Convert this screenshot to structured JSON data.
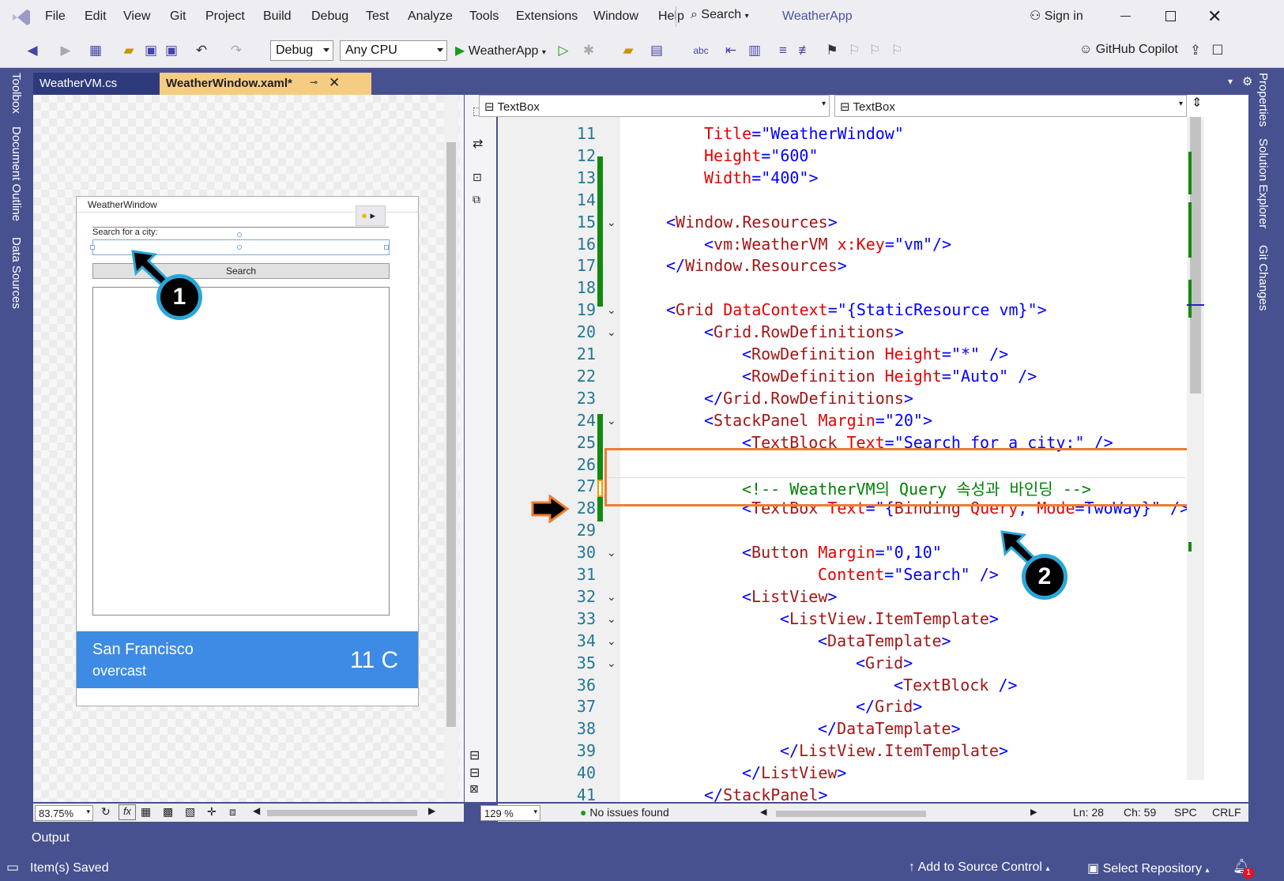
{
  "menu": {
    "items": [
      "File",
      "Edit",
      "View",
      "Git",
      "Project",
      "Build",
      "Debug",
      "Test",
      "Analyze",
      "Tools",
      "Extensions",
      "Window",
      "Help"
    ],
    "search_label": "Search",
    "app_title": "WeatherApp",
    "sign_in": "Sign in"
  },
  "toolbar": {
    "config": "Debug",
    "platform": "Any CPU",
    "run_target": "WeatherApp",
    "copilot": "GitHub Copilot"
  },
  "side_tabs": {
    "left": [
      "Toolbox",
      "Document Outline",
      "Data Sources"
    ],
    "right": [
      "Properties",
      "Solution Explorer",
      "Git Changes"
    ]
  },
  "tabs": [
    {
      "label": "WeatherVM.cs",
      "active": false
    },
    {
      "label": "WeatherWindow.xaml*",
      "active": true
    }
  ],
  "designer": {
    "window_title": "WeatherWindow",
    "search_label": "Search for a city:",
    "button_label": "Search",
    "city": "San Francisco",
    "condition": "overcast",
    "temperature": "11 C",
    "zoom": "83.75%"
  },
  "editor": {
    "element_dropdown_left": "TextBox",
    "element_dropdown_right": "TextBox",
    "zoom": "129 %",
    "issues": "No issues found",
    "ln": "Ln: 28",
    "ch": "Ch: 59",
    "spc": "SPC",
    "crlf": "CRLF",
    "lines": [
      {
        "n": "11",
        "indent": 2,
        "parts": [
          [
            "at",
            "Title"
          ],
          [
            "blue",
            "="
          ],
          [
            "val",
            "\"WeatherWindow\""
          ]
        ]
      },
      {
        "n": "12",
        "indent": 2,
        "parts": [
          [
            "at",
            "Height"
          ],
          [
            "blue",
            "="
          ],
          [
            "val",
            "\"600\""
          ]
        ]
      },
      {
        "n": "13",
        "indent": 2,
        "parts": [
          [
            "at",
            "Width"
          ],
          [
            "blue",
            "="
          ],
          [
            "val",
            "\"400\""
          ],
          [
            "blue",
            ">"
          ]
        ]
      },
      {
        "n": "14",
        "indent": 0,
        "parts": []
      },
      {
        "n": "15",
        "indent": 1,
        "parts": [
          [
            "blue",
            "<"
          ],
          [
            "tag",
            "Window.Resources"
          ],
          [
            "blue",
            ">"
          ]
        ]
      },
      {
        "n": "16",
        "indent": 2,
        "parts": [
          [
            "blue",
            "<"
          ],
          [
            "tag",
            "vm:WeatherVM"
          ],
          [
            "blue",
            " "
          ],
          [
            "at",
            "x:Key"
          ],
          [
            "blue",
            "="
          ],
          [
            "val",
            "\"vm\""
          ],
          [
            "blue",
            "/>"
          ]
        ]
      },
      {
        "n": "17",
        "indent": 1,
        "parts": [
          [
            "blue",
            "</"
          ],
          [
            "tag",
            "Window.Resources"
          ],
          [
            "blue",
            ">"
          ]
        ]
      },
      {
        "n": "18",
        "indent": 0,
        "parts": []
      },
      {
        "n": "19",
        "indent": 1,
        "parts": [
          [
            "blue",
            "<"
          ],
          [
            "tag",
            "Grid"
          ],
          [
            "blue",
            " "
          ],
          [
            "at",
            "DataContext"
          ],
          [
            "blue",
            "="
          ],
          [
            "val",
            "\"{StaticResource vm}\""
          ],
          [
            "blue",
            ">"
          ]
        ]
      },
      {
        "n": "20",
        "indent": 2,
        "parts": [
          [
            "blue",
            "<"
          ],
          [
            "tag",
            "Grid.RowDefinitions"
          ],
          [
            "blue",
            ">"
          ]
        ]
      },
      {
        "n": "21",
        "indent": 3,
        "parts": [
          [
            "blue",
            "<"
          ],
          [
            "tag",
            "RowDefinition"
          ],
          [
            "blue",
            " "
          ],
          [
            "at",
            "Height"
          ],
          [
            "blue",
            "="
          ],
          [
            "val",
            "\"*\""
          ],
          [
            "blue",
            " />"
          ]
        ]
      },
      {
        "n": "22",
        "indent": 3,
        "parts": [
          [
            "blue",
            "<"
          ],
          [
            "tag",
            "RowDefinition"
          ],
          [
            "blue",
            " "
          ],
          [
            "at",
            "Height"
          ],
          [
            "blue",
            "="
          ],
          [
            "val",
            "\"Auto\""
          ],
          [
            "blue",
            " />"
          ]
        ]
      },
      {
        "n": "23",
        "indent": 2,
        "parts": [
          [
            "blue",
            "</"
          ],
          [
            "tag",
            "Grid.RowDefinitions"
          ],
          [
            "blue",
            ">"
          ]
        ]
      },
      {
        "n": "24",
        "indent": 2,
        "parts": [
          [
            "blue",
            "<"
          ],
          [
            "tag",
            "StackPanel"
          ],
          [
            "blue",
            " "
          ],
          [
            "at",
            "Margin"
          ],
          [
            "blue",
            "="
          ],
          [
            "val",
            "\"20\""
          ],
          [
            "blue",
            ">"
          ]
        ]
      },
      {
        "n": "25",
        "indent": 3,
        "parts": [
          [
            "blue",
            "<"
          ],
          [
            "tag",
            "TextBlock"
          ],
          [
            "blue",
            " "
          ],
          [
            "at",
            "Text"
          ],
          [
            "blue",
            "="
          ],
          [
            "val",
            "\"Search for a city:\""
          ],
          [
            "blue",
            " />"
          ]
        ]
      },
      {
        "n": "26",
        "indent": 0,
        "parts": []
      },
      {
        "n": "27",
        "indent": 3,
        "parts": [
          [
            "com",
            "<!-- WeatherVM의 Query 속성과 바인딩 -->"
          ]
        ]
      },
      {
        "n": "28",
        "indent": 3,
        "parts": [
          [
            "blue",
            "<"
          ],
          [
            "tag",
            "TextBox"
          ],
          [
            "blue",
            " "
          ],
          [
            "at",
            "Text"
          ],
          [
            "blue",
            "=\"{"
          ],
          [
            "tag",
            "Binding"
          ],
          [
            "blue",
            " "
          ],
          [
            "at",
            "Query"
          ],
          [
            "blue",
            ", "
          ],
          [
            "at",
            "Mode"
          ],
          [
            "blue",
            "=TwoWay}\""
          ],
          [
            "blue",
            " />"
          ]
        ]
      },
      {
        "n": "29",
        "indent": 0,
        "parts": []
      },
      {
        "n": "30",
        "indent": 3,
        "parts": [
          [
            "blue",
            "<"
          ],
          [
            "tag",
            "Button"
          ],
          [
            "blue",
            " "
          ],
          [
            "at",
            "Margin"
          ],
          [
            "blue",
            "="
          ],
          [
            "val",
            "\"0,10\""
          ]
        ]
      },
      {
        "n": "31",
        "indent": 5,
        "parts": [
          [
            "at",
            "Content"
          ],
          [
            "blue",
            "="
          ],
          [
            "val",
            "\"Search\""
          ],
          [
            "blue",
            " />"
          ]
        ]
      },
      {
        "n": "32",
        "indent": 3,
        "parts": [
          [
            "blue",
            "<"
          ],
          [
            "tag",
            "ListView"
          ],
          [
            "blue",
            ">"
          ]
        ]
      },
      {
        "n": "33",
        "indent": 4,
        "parts": [
          [
            "blue",
            "<"
          ],
          [
            "tag",
            "ListView.ItemTemplate"
          ],
          [
            "blue",
            ">"
          ]
        ]
      },
      {
        "n": "34",
        "indent": 5,
        "parts": [
          [
            "blue",
            "<"
          ],
          [
            "tag",
            "DataTemplate"
          ],
          [
            "blue",
            ">"
          ]
        ]
      },
      {
        "n": "35",
        "indent": 6,
        "parts": [
          [
            "blue",
            "<"
          ],
          [
            "tag",
            "Grid"
          ],
          [
            "blue",
            ">"
          ]
        ]
      },
      {
        "n": "36",
        "indent": 7,
        "parts": [
          [
            "blue",
            "<"
          ],
          [
            "tag",
            "TextBlock"
          ],
          [
            "blue",
            " />"
          ]
        ]
      },
      {
        "n": "37",
        "indent": 6,
        "parts": [
          [
            "blue",
            "</"
          ],
          [
            "tag",
            "Grid"
          ],
          [
            "blue",
            ">"
          ]
        ]
      },
      {
        "n": "38",
        "indent": 5,
        "parts": [
          [
            "blue",
            "</"
          ],
          [
            "tag",
            "DataTemplate"
          ],
          [
            "blue",
            ">"
          ]
        ]
      },
      {
        "n": "39",
        "indent": 4,
        "parts": [
          [
            "blue",
            "</"
          ],
          [
            "tag",
            "ListView.ItemTemplate"
          ],
          [
            "blue",
            ">"
          ]
        ]
      },
      {
        "n": "40",
        "indent": 3,
        "parts": [
          [
            "blue",
            "</"
          ],
          [
            "tag",
            "ListView"
          ],
          [
            "blue",
            ">"
          ]
        ]
      },
      {
        "n": "41",
        "indent": 2,
        "parts": [
          [
            "blue",
            "</"
          ],
          [
            "tag",
            "StackPanel"
          ],
          [
            "blue",
            ">"
          ]
        ]
      }
    ]
  },
  "output_label": "Output",
  "status": {
    "left": "Item(s) Saved",
    "source_control": "Add to Source Control",
    "repo": "Select Repository",
    "notifications": "1"
  },
  "callouts": [
    "1",
    "2"
  ]
}
